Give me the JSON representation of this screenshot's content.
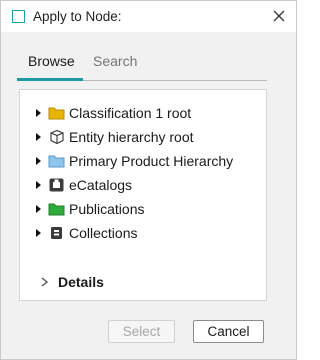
{
  "window": {
    "title": "Apply to Node:"
  },
  "tabs": [
    {
      "label": "Browse",
      "active": true
    },
    {
      "label": "Search",
      "active": false
    }
  ],
  "tree": [
    {
      "label": "Classification 1 root",
      "icon": "folder-icon",
      "color": "#e8b400"
    },
    {
      "label": "Entity hierarchy root",
      "icon": "cube-icon",
      "color": "#333333"
    },
    {
      "label": "Primary Product Hierarchy",
      "icon": "folder-icon",
      "color": "#7cb9e8"
    },
    {
      "label": "eCatalogs",
      "icon": "catalog-icon",
      "color": "#333333"
    },
    {
      "label": "Publications",
      "icon": "folder-icon",
      "color": "#2eaa3a"
    },
    {
      "label": "Collections",
      "icon": "collection-icon",
      "color": "#333333"
    }
  ],
  "details": {
    "label": "Details"
  },
  "buttons": {
    "select": "Select",
    "cancel": "Cancel"
  },
  "colors": {
    "accent": "#1d9aa2"
  }
}
